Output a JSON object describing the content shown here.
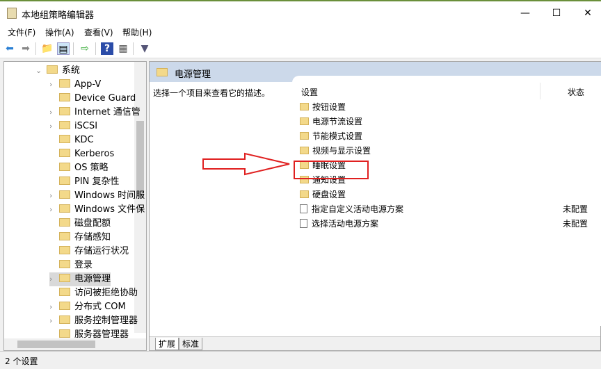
{
  "window": {
    "title": "本地组策略编辑器",
    "minimize": "—",
    "maximize": "☐",
    "close": "✕"
  },
  "menu": [
    "文件(F)",
    "操作(A)",
    "查看(V)",
    "帮助(H)"
  ],
  "toolbar": [
    "back-icon",
    "forward-icon",
    "up-folder-icon",
    "show-hide-tree-icon",
    "export-icon",
    "help-icon",
    "properties-icon",
    "filter-icon"
  ],
  "tree": {
    "root": "系统",
    "items": [
      {
        "label": "App-V",
        "expandable": true
      },
      {
        "label": "Device Guard",
        "expandable": false
      },
      {
        "label": "Internet 通信管",
        "expandable": true
      },
      {
        "label": "iSCSI",
        "expandable": true
      },
      {
        "label": "KDC",
        "expandable": false
      },
      {
        "label": "Kerberos",
        "expandable": false
      },
      {
        "label": "OS 策略",
        "expandable": false
      },
      {
        "label": "PIN 复杂性",
        "expandable": false
      },
      {
        "label": "Windows 时间服",
        "expandable": true
      },
      {
        "label": "Windows 文件保",
        "expandable": true
      },
      {
        "label": "磁盘配额",
        "expandable": false
      },
      {
        "label": "存储感知",
        "expandable": false
      },
      {
        "label": "存储运行状况",
        "expandable": false
      },
      {
        "label": "登录",
        "expandable": false
      },
      {
        "label": "电源管理",
        "expandable": true,
        "selected": true
      },
      {
        "label": "访问被拒绝协助",
        "expandable": false
      },
      {
        "label": "分布式 COM",
        "expandable": true
      },
      {
        "label": "服务控制管理器",
        "expandable": true
      },
      {
        "label": "服务器管理器",
        "expandable": false
      }
    ]
  },
  "detail": {
    "header": "电源管理",
    "description": "选择一个项目来查看它的描述。",
    "col_setting": "设置",
    "col_state": "状态",
    "rows": [
      {
        "label": "按钮设置",
        "type": "folder",
        "state": ""
      },
      {
        "label": "电源节流设置",
        "type": "folder",
        "state": ""
      },
      {
        "label": "节能模式设置",
        "type": "folder",
        "state": ""
      },
      {
        "label": "视频与显示设置",
        "type": "folder",
        "state": ""
      },
      {
        "label": "睡眠设置",
        "type": "folder",
        "state": "",
        "highlighted": true
      },
      {
        "label": "通知设置",
        "type": "folder",
        "state": ""
      },
      {
        "label": "硬盘设置",
        "type": "folder",
        "state": ""
      },
      {
        "label": "指定自定义活动电源方案",
        "type": "policy",
        "state": "未配置"
      },
      {
        "label": "选择活动电源方案",
        "type": "policy",
        "state": "未配置"
      }
    ],
    "tabs": [
      "扩展",
      "标准"
    ]
  },
  "status": "2 个设置",
  "annotation_color": "#e02020"
}
